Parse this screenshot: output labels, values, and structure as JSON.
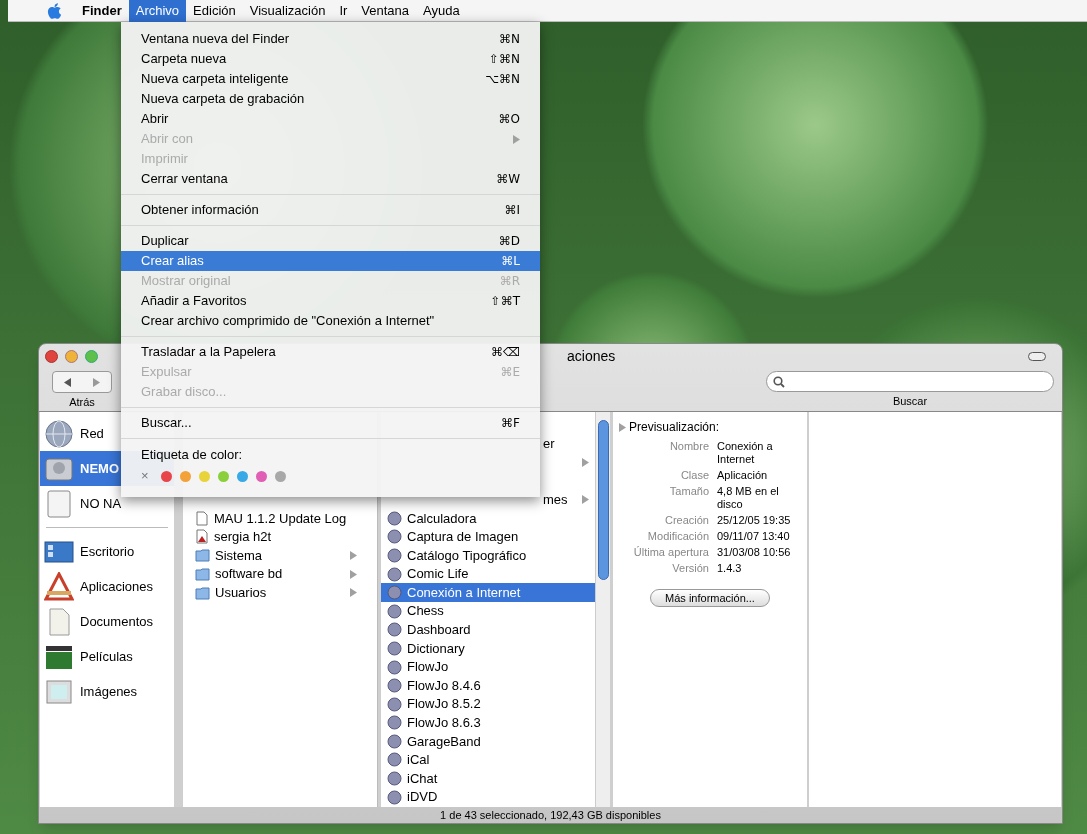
{
  "menubar": {
    "items": [
      {
        "label": "Finder",
        "selected": false,
        "bold": true
      },
      {
        "label": "Archivo",
        "selected": true,
        "bold": false
      },
      {
        "label": "Edición",
        "selected": false,
        "bold": false
      },
      {
        "label": "Visualización",
        "selected": false,
        "bold": false
      },
      {
        "label": "Ir",
        "selected": false,
        "bold": false
      },
      {
        "label": "Ventana",
        "selected": false,
        "bold": false
      },
      {
        "label": "Ayuda",
        "selected": false,
        "bold": false
      }
    ]
  },
  "menu": {
    "items": [
      {
        "kind": "item",
        "label": "Ventana nueva del Finder",
        "shortcut": "⌘N",
        "disabled": false,
        "selected": false
      },
      {
        "kind": "item",
        "label": "Carpeta nueva",
        "shortcut": "⇧⌘N",
        "disabled": false,
        "selected": false
      },
      {
        "kind": "item",
        "label": "Nueva carpeta inteligente",
        "shortcut": "⌥⌘N",
        "disabled": false,
        "selected": false
      },
      {
        "kind": "item",
        "label": "Nueva carpeta de grabación",
        "disabled": false,
        "selected": false
      },
      {
        "kind": "item",
        "label": "Abrir",
        "shortcut": "⌘O",
        "disabled": false,
        "selected": false
      },
      {
        "kind": "submenu",
        "label": "Abrir con",
        "disabled": true,
        "selected": false
      },
      {
        "kind": "item",
        "label": "Imprimir",
        "disabled": true,
        "selected": false
      },
      {
        "kind": "item",
        "label": "Cerrar ventana",
        "shortcut": "⌘W",
        "disabled": false,
        "selected": false
      },
      {
        "kind": "separator"
      },
      {
        "kind": "item",
        "label": "Obtener información",
        "shortcut": "⌘I",
        "disabled": false,
        "selected": false
      },
      {
        "kind": "separator"
      },
      {
        "kind": "item",
        "label": "Duplicar",
        "shortcut": "⌘D",
        "disabled": false,
        "selected": false
      },
      {
        "kind": "item",
        "label": "Crear alias",
        "shortcut": "⌘L",
        "disabled": false,
        "selected": true
      },
      {
        "kind": "item",
        "label": "Mostrar original",
        "shortcut": "⌘R",
        "disabled": true,
        "selected": false
      },
      {
        "kind": "item",
        "label": "Añadir a Favoritos",
        "shortcut": "⇧⌘T",
        "disabled": false,
        "selected": false
      },
      {
        "kind": "item",
        "label": "Crear archivo comprimido de \"Conexión a Internet\"",
        "disabled": false,
        "selected": false
      },
      {
        "kind": "separator"
      },
      {
        "kind": "item",
        "label": "Trasladar a la Papelera",
        "shortcut": "⌘⌫",
        "disabled": false,
        "selected": false
      },
      {
        "kind": "item",
        "label": "Expulsar",
        "shortcut": "⌘E",
        "disabled": true,
        "selected": false
      },
      {
        "kind": "item",
        "label": "Grabar disco...",
        "disabled": true,
        "selected": false
      },
      {
        "kind": "separator"
      },
      {
        "kind": "item",
        "label": "Buscar...",
        "shortcut": "⌘F",
        "disabled": false,
        "selected": false
      },
      {
        "kind": "separator"
      },
      {
        "kind": "heading",
        "label": "Etiqueta de color:"
      },
      {
        "kind": "colors",
        "none": "×",
        "colors": [
          {
            "color": "#e8454a"
          },
          {
            "color": "#f3a23a"
          },
          {
            "color": "#e8d33a"
          },
          {
            "color": "#8ccf3c"
          },
          {
            "color": "#36a9e6"
          },
          {
            "color": "#e05fb5"
          },
          {
            "color": "#a8a8a8"
          }
        ]
      }
    ]
  },
  "window": {
    "title": "aciones",
    "back_label": "Atrás",
    "search_label": "Buscar",
    "sidebar": {
      "volumes": [
        {
          "label": "Red",
          "kind": "network",
          "selected": false
        },
        {
          "label": "NEMO",
          "kind": "harddrive",
          "selected": true
        },
        {
          "label": "NO NA",
          "kind": "drive",
          "selected": false
        }
      ],
      "places": [
        {
          "label": "Escritorio",
          "kind": "desktop",
          "selected": false
        },
        {
          "label": "Aplicaciones",
          "kind": "applications",
          "selected": false
        },
        {
          "label": "Documentos",
          "kind": "documents",
          "selected": false
        },
        {
          "label": "Películas",
          "kind": "movies",
          "selected": false
        },
        {
          "label": "Imágenes",
          "kind": "pictures",
          "selected": false
        }
      ]
    },
    "column_2": [
      {
        "kind": "hidden"
      },
      {
        "kind": "hidden"
      },
      {
        "kind": "hidden"
      },
      {
        "kind": "hidden"
      },
      {
        "kind": "hidden"
      },
      {
        "kind": "document",
        "label": "MAU 1.1.2 Update Log"
      },
      {
        "kind": "pdf",
        "label": "sergia h2t"
      },
      {
        "kind": "folder",
        "label": "Sistema"
      },
      {
        "kind": "folder",
        "label": "software bd"
      },
      {
        "kind": "folder",
        "label": "Usuarios"
      }
    ],
    "column_3": [
      {
        "kind": "hidden"
      },
      {
        "kind": "partial",
        "label": "er"
      },
      {
        "kind": "hidden-folder"
      },
      {
        "kind": "hidden"
      },
      {
        "kind": "partial-folder",
        "label": "mes"
      },
      {
        "kind": "application",
        "label": "Calculadora",
        "selected": false
      },
      {
        "kind": "application",
        "label": "Captura de Imagen",
        "selected": false
      },
      {
        "kind": "application",
        "label": "Catálogo Tipográfico",
        "selected": false
      },
      {
        "kind": "application",
        "label": "Comic Life",
        "selected": false
      },
      {
        "kind": "application",
        "label": "Conexión a Internet",
        "selected": true
      },
      {
        "kind": "application",
        "label": "Chess",
        "selected": false
      },
      {
        "kind": "application",
        "label": "Dashboard",
        "selected": false
      },
      {
        "kind": "application",
        "label": "Dictionary",
        "selected": false
      },
      {
        "kind": "application",
        "label": "FlowJo",
        "selected": false
      },
      {
        "kind": "application",
        "label": "FlowJo 8.4.6",
        "selected": false
      },
      {
        "kind": "application",
        "label": "FlowJo 8.5.2",
        "selected": false
      },
      {
        "kind": "application",
        "label": "FlowJo 8.6.3",
        "selected": false
      },
      {
        "kind": "application",
        "label": "GarageBand",
        "selected": false
      },
      {
        "kind": "application",
        "label": "iCal",
        "selected": false
      },
      {
        "kind": "application",
        "label": "iChat",
        "selected": false
      },
      {
        "kind": "application",
        "label": "iDVD",
        "selected": false
      }
    ],
    "preview": {
      "heading": "Previsualización:",
      "fields": [
        {
          "label": "Nombre",
          "value": "Conexión a Internet"
        },
        {
          "label": "Clase",
          "value": "Aplicación"
        },
        {
          "label": "Tamaño",
          "value": "4,8 MB en el disco"
        },
        {
          "label": "Creación",
          "value": "25/12/05 19:35"
        },
        {
          "label": "Modificación",
          "value": "09/11/07 13:40"
        },
        {
          "label": "Última apertura",
          "value": "31/03/08 10:56"
        },
        {
          "label": "Versión",
          "value": "1.4.3"
        }
      ],
      "button": "Más información..."
    },
    "status": "1 de 43 seleccionado, 192,43 GB disponibles"
  }
}
